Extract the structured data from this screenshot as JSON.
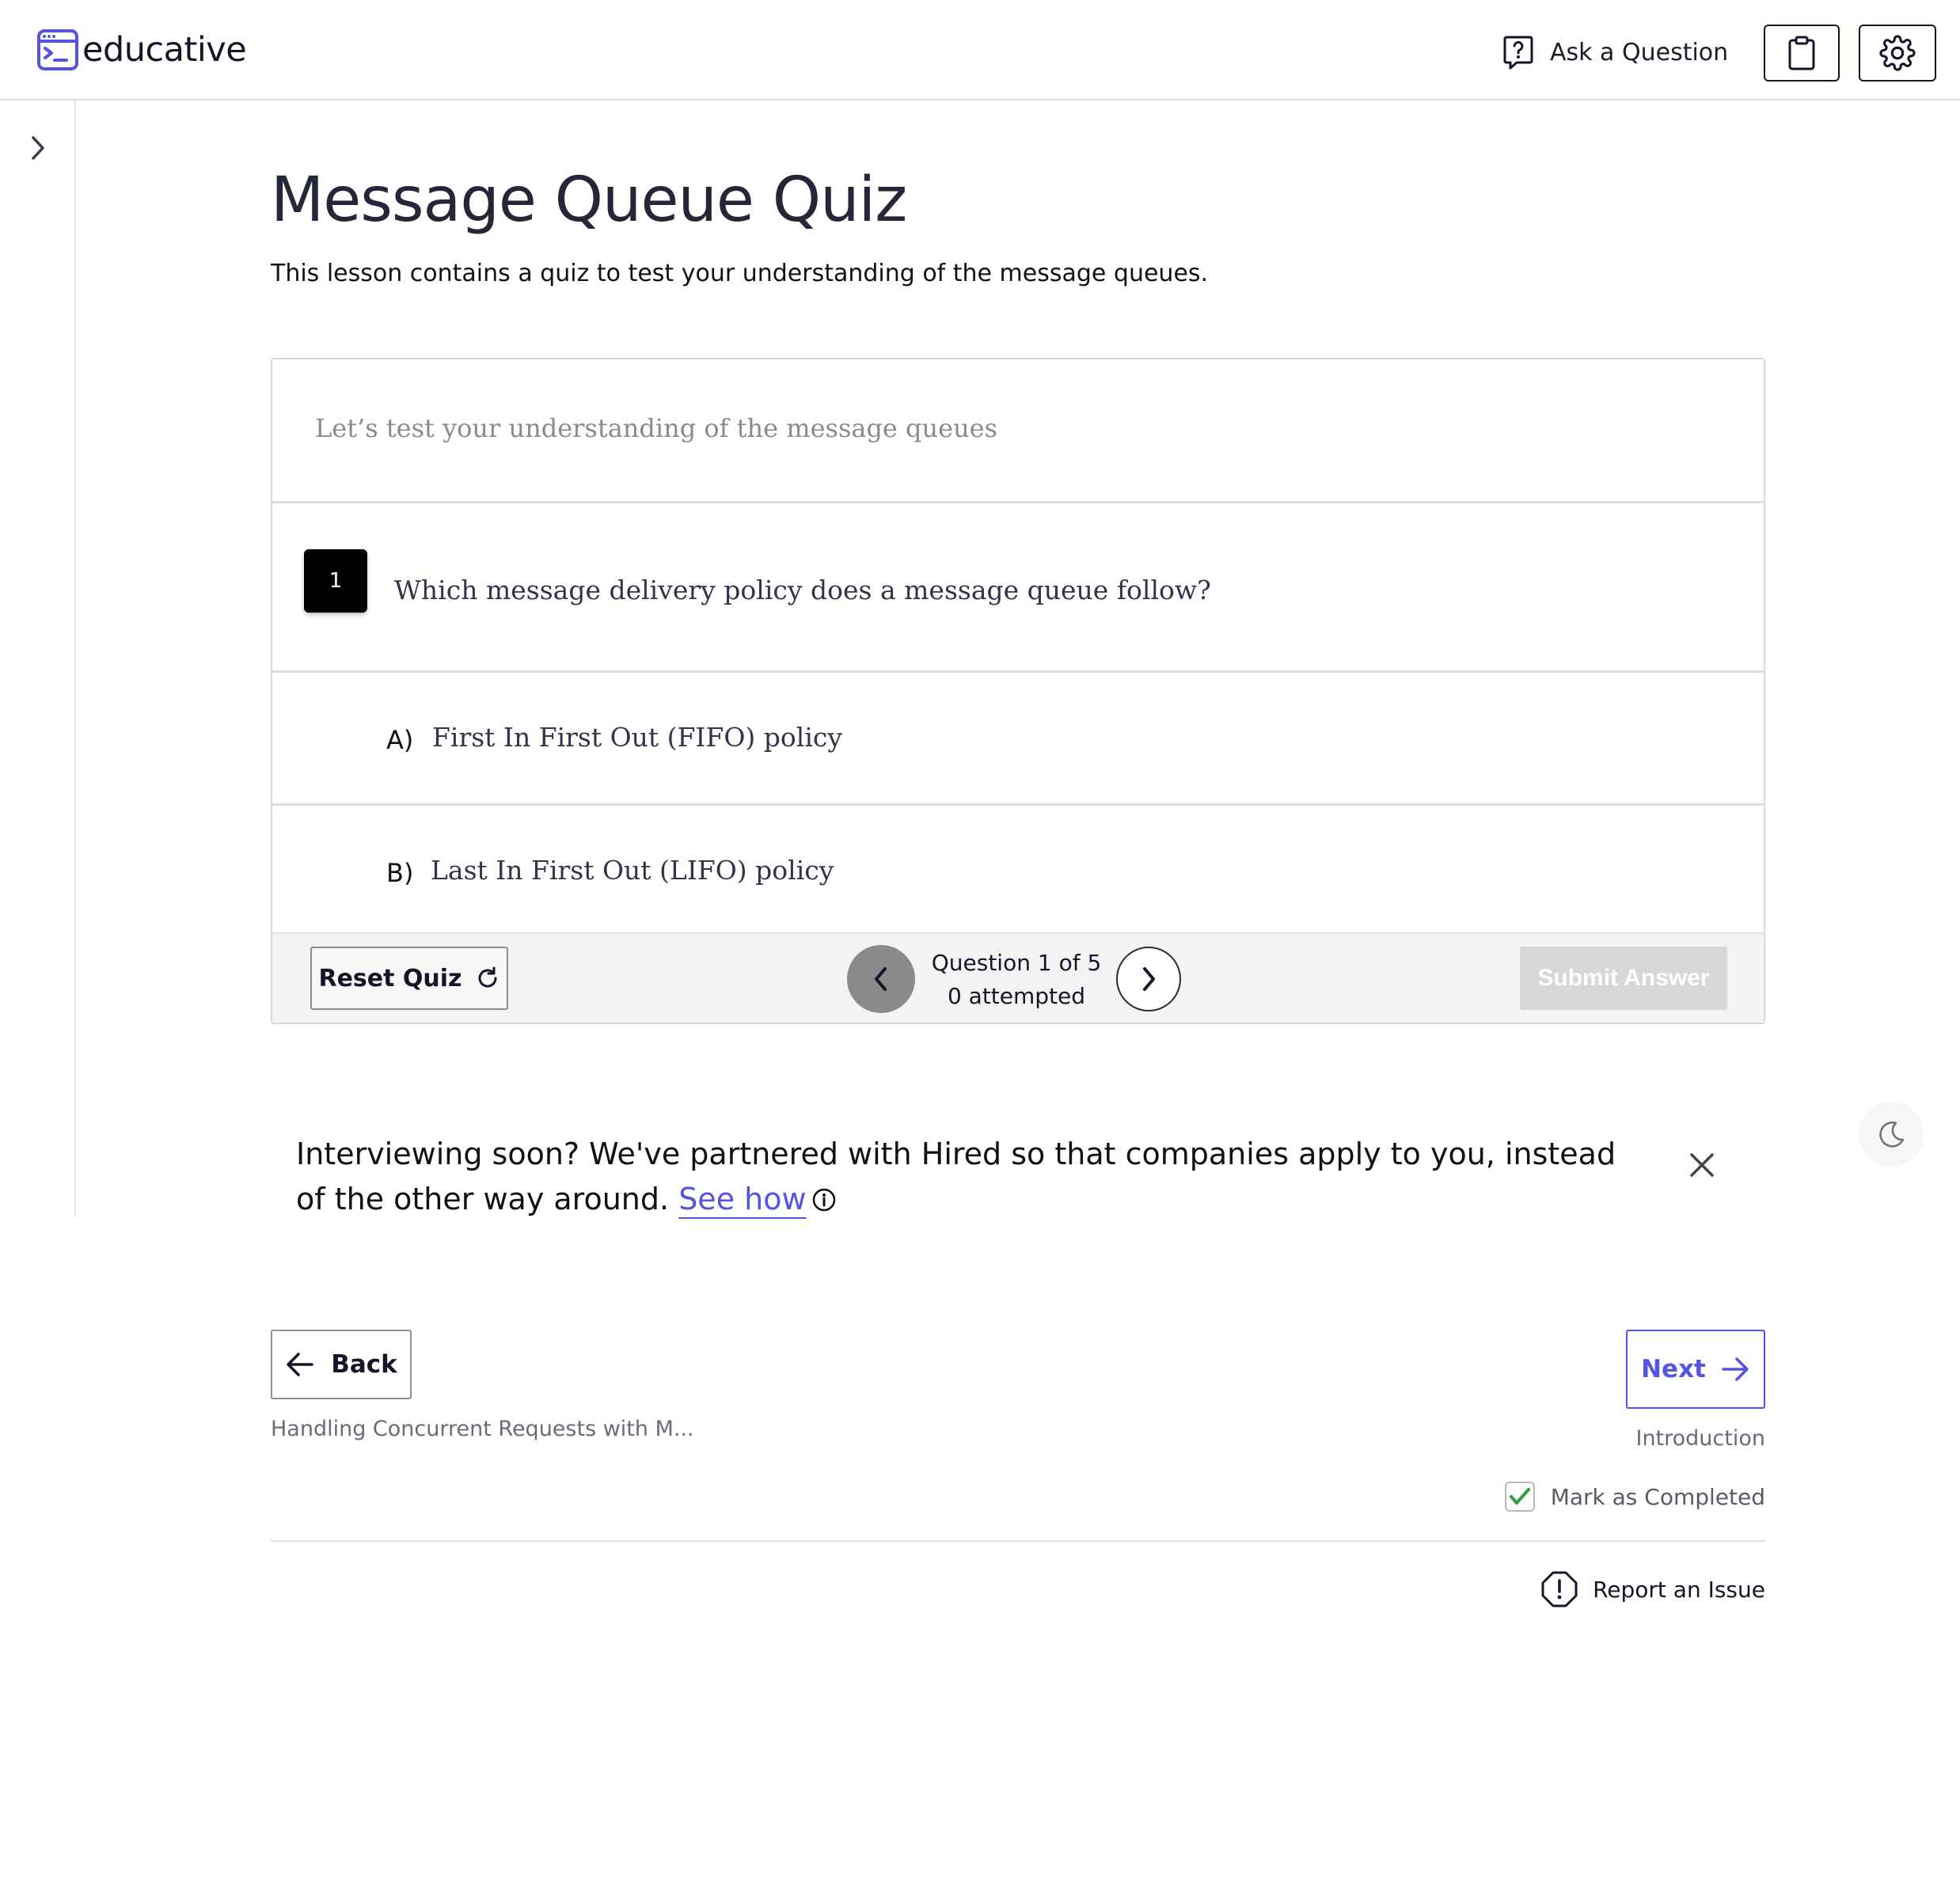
{
  "header": {
    "logo_text": "educative",
    "ask_question_label": "Ask a Question"
  },
  "lesson": {
    "title": "Message Queue Quiz",
    "subtitle": "This lesson contains a quiz to test your understanding of the message queues."
  },
  "quiz": {
    "intro": "Let’s test your understanding of the message queues",
    "question_number": "1",
    "question_text": "Which message delivery policy does a message queue follow?",
    "options": [
      {
        "letter": "A)",
        "text": "First In First Out (FIFO) policy"
      },
      {
        "letter": "B)",
        "text": "Last In First Out (LIFO) policy"
      }
    ],
    "reset_label": "Reset Quiz",
    "progress_line1": "Question 1 of 5",
    "progress_line2": "0 attempted",
    "submit_label": "Submit Answer"
  },
  "promo": {
    "text": "Interviewing soon? We've partnered with Hired so that companies apply to you, instead of the other way around.",
    "link_text": "See how"
  },
  "navigation": {
    "back_label": "Back",
    "back_caption": "Handling Concurrent Requests with M...",
    "next_label": "Next",
    "next_caption": "Introduction",
    "mark_completed_label": "Mark as Completed",
    "mark_completed_checked": true,
    "report_label": "Report an Issue"
  },
  "colors": {
    "accent": "#5553e3",
    "text_dark": "#26263a",
    "check_green": "#2e9e3f",
    "submit_disabled": "#d7d7d7"
  }
}
